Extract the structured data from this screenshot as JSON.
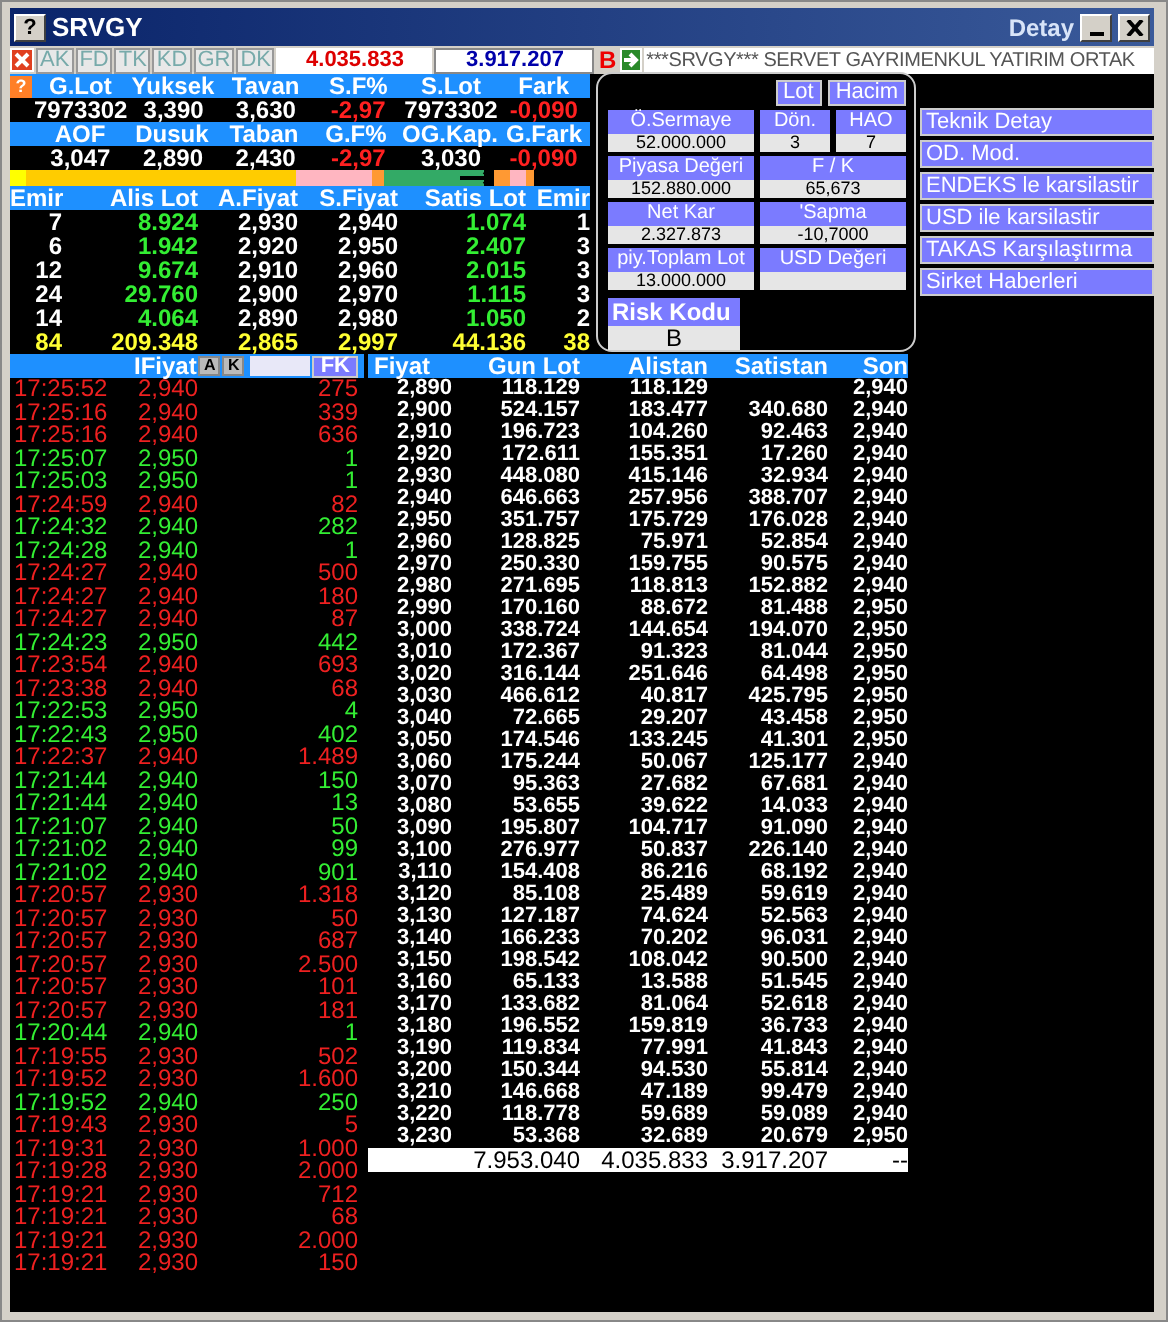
{
  "window": {
    "help": "?",
    "title": "SRVGY",
    "ghost_title": "Detay"
  },
  "toolbar": {
    "tabs": [
      {
        "label": "AK",
        "disabled": true
      },
      {
        "label": "FD",
        "disabled": true
      },
      {
        "label": "TK",
        "disabled": true
      },
      {
        "label": "KD",
        "disabled": true
      },
      {
        "label": "GR",
        "disabled": true
      },
      {
        "label": "DK",
        "disabled": true
      }
    ],
    "buy_total": "4.035.833",
    "sell_total": "3.917.207",
    "risk_letter": "B",
    "ticker": "***SRVGY*** SERVET GAYRIMENKUL YATIRIM ORTAK"
  },
  "stats": {
    "help": "?",
    "rows": [
      {
        "labels": [
          "G.Lot",
          "Yuksek",
          "Tavan",
          "S.F%",
          "S.Lot",
          "Fark"
        ],
        "values": [
          {
            "text": "7973302",
            "negative": false
          },
          {
            "text": "3,390",
            "negative": false
          },
          {
            "text": "3,630",
            "negative": false
          },
          {
            "text": "-2,97",
            "negative": true
          },
          {
            "text": "7973302",
            "negative": false
          },
          {
            "text": "-0,090",
            "negative": true
          }
        ]
      },
      {
        "labels": [
          "AOF",
          "Dusuk",
          "Taban",
          "G.F%",
          "OG.Kap.",
          "G.Fark"
        ],
        "values": [
          {
            "text": "3,047",
            "negative": false
          },
          {
            "text": "2,890",
            "negative": false
          },
          {
            "text": "2,430",
            "negative": false
          },
          {
            "text": "-2,97",
            "negative": true
          },
          {
            "text": "3,030",
            "negative": false
          },
          {
            "text": "-0,090",
            "negative": true
          }
        ]
      }
    ]
  },
  "orderbook": {
    "columns": [
      "Emir",
      "Alis Lot",
      "A.Fiyat",
      "S.Fiyat",
      "Satis Lot",
      "Emir"
    ],
    "rows": [
      [
        "7",
        "8.924",
        "2,930",
        "2,940",
        "1.074",
        "1"
      ],
      [
        "6",
        "1.942",
        "2,920",
        "2,950",
        "2.407",
        "3"
      ],
      [
        "12",
        "9.674",
        "2,910",
        "2,960",
        "2.015",
        "3"
      ],
      [
        "24",
        "29.760",
        "2,900",
        "2,970",
        "1.115",
        "3"
      ],
      [
        "14",
        "4.064",
        "2,890",
        "2,980",
        "1.050",
        "2"
      ]
    ],
    "total": [
      "84",
      "209.348",
      "2,865",
      "2,997",
      "44.136",
      "38"
    ]
  },
  "info_panel": {
    "toggles": [
      "Lot",
      "Hacim"
    ],
    "fields": [
      {
        "label": "Ö.Sermaye",
        "value": "52.000.000"
      },
      {
        "label": "Dön.",
        "value": "3"
      },
      {
        "label": "HAO",
        "value": "7"
      },
      {
        "label": "Piyasa Değeri",
        "value": "152.880.000"
      },
      {
        "label": "F / K",
        "value": "65,673"
      },
      {
        "label": "Net Kar",
        "value": "2.327.873"
      },
      {
        "label": "'Sapma",
        "value": "-10,7000"
      },
      {
        "label": "piy.Toplam Lot",
        "value": "13.000.000"
      },
      {
        "label": "USD Değeri"
      }
    ],
    "risk_label": "Risk Kodu",
    "risk_value": "B"
  },
  "links": [
    "Teknik Detay",
    "OD. Mod.",
    "ENDEKS le karsilastir",
    "USD ile karsilastir",
    "TAKAS Karşılaştırma",
    "Sirket Haberleri"
  ],
  "trades": {
    "header": "IFiyat",
    "buttons": [
      "A",
      "K"
    ],
    "filter_button": "FK",
    "rows": [
      {
        "time": "17:25:52",
        "price": "2,940",
        "lot": "275",
        "kind": "sell"
      },
      {
        "time": "17:25:16",
        "price": "2,940",
        "lot": "339",
        "kind": "sell"
      },
      {
        "time": "17:25:16",
        "price": "2,940",
        "lot": "636",
        "kind": "sell"
      },
      {
        "time": "17:25:07",
        "price": "2,950",
        "lot": "1",
        "kind": "buy"
      },
      {
        "time": "17:25:03",
        "price": "2,950",
        "lot": "1",
        "kind": "buy"
      },
      {
        "time": "17:24:59",
        "price": "2,940",
        "lot": "82",
        "kind": "sell"
      },
      {
        "time": "17:24:32",
        "price": "2,940",
        "lot": "282",
        "kind": "buy"
      },
      {
        "time": "17:24:28",
        "price": "2,940",
        "lot": "1",
        "kind": "buy"
      },
      {
        "time": "17:24:27",
        "price": "2,940",
        "lot": "500",
        "kind": "sell"
      },
      {
        "time": "17:24:27",
        "price": "2,940",
        "lot": "180",
        "kind": "sell"
      },
      {
        "time": "17:24:27",
        "price": "2,940",
        "lot": "87",
        "kind": "sell"
      },
      {
        "time": "17:24:23",
        "price": "2,950",
        "lot": "442",
        "kind": "buy"
      },
      {
        "time": "17:23:54",
        "price": "2,940",
        "lot": "693",
        "kind": "sell"
      },
      {
        "time": "17:23:38",
        "price": "2,940",
        "lot": "68",
        "kind": "sell"
      },
      {
        "time": "17:22:53",
        "price": "2,950",
        "lot": "4",
        "kind": "buy"
      },
      {
        "time": "17:22:43",
        "price": "2,950",
        "lot": "402",
        "kind": "buy"
      },
      {
        "time": "17:22:37",
        "price": "2,940",
        "lot": "1.489",
        "kind": "sell"
      },
      {
        "time": "17:21:44",
        "price": "2,940",
        "lot": "150",
        "kind": "buy"
      },
      {
        "time": "17:21:44",
        "price": "2,940",
        "lot": "13",
        "kind": "buy"
      },
      {
        "time": "17:21:07",
        "price": "2,940",
        "lot": "50",
        "kind": "buy"
      },
      {
        "time": "17:21:02",
        "price": "2,940",
        "lot": "99",
        "kind": "buy"
      },
      {
        "time": "17:21:02",
        "price": "2,940",
        "lot": "901",
        "kind": "buy"
      },
      {
        "time": "17:20:57",
        "price": "2,930",
        "lot": "1.318",
        "kind": "sell"
      },
      {
        "time": "17:20:57",
        "price": "2,930",
        "lot": "50",
        "kind": "sell"
      },
      {
        "time": "17:20:57",
        "price": "2,930",
        "lot": "687",
        "kind": "sell"
      },
      {
        "time": "17:20:57",
        "price": "2,930",
        "lot": "2.500",
        "kind": "sell"
      },
      {
        "time": "17:20:57",
        "price": "2,930",
        "lot": "101",
        "kind": "sell"
      },
      {
        "time": "17:20:57",
        "price": "2,930",
        "lot": "181",
        "kind": "sell"
      },
      {
        "time": "17:20:44",
        "price": "2,940",
        "lot": "1",
        "kind": "buy"
      },
      {
        "time": "17:19:55",
        "price": "2,930",
        "lot": "502",
        "kind": "sell"
      },
      {
        "time": "17:19:52",
        "price": "2,930",
        "lot": "1.600",
        "kind": "sell"
      },
      {
        "time": "17:19:52",
        "price": "2,940",
        "lot": "250",
        "kind": "buy"
      },
      {
        "time": "17:19:43",
        "price": "2,930",
        "lot": "5",
        "kind": "sell"
      },
      {
        "time": "17:19:31",
        "price": "2,930",
        "lot": "1.000",
        "kind": "sell"
      },
      {
        "time": "17:19:28",
        "price": "2,930",
        "lot": "2.000",
        "kind": "sell"
      },
      {
        "time": "17:19:21",
        "price": "2,930",
        "lot": "712",
        "kind": "sell"
      },
      {
        "time": "17:19:21",
        "price": "2,930",
        "lot": "68",
        "kind": "sell"
      },
      {
        "time": "17:19:21",
        "price": "2,930",
        "lot": "2.000",
        "kind": "sell"
      },
      {
        "time": "17:19:21",
        "price": "2,930",
        "lot": "150",
        "kind": "sell"
      }
    ]
  },
  "depth": {
    "columns": [
      "Fiyat",
      "Gun Lot",
      "Alistan",
      "Satistan",
      "Son"
    ],
    "rows": [
      [
        "2,890",
        "118.129",
        "118.129",
        null,
        "2,940"
      ],
      [
        "2,900",
        "524.157",
        "183.477",
        "340.680",
        "2,940"
      ],
      [
        "2,910",
        "196.723",
        "104.260",
        "92.463",
        "2,940"
      ],
      [
        "2,920",
        "172.611",
        "155.351",
        "17.260",
        "2,940"
      ],
      [
        "2,930",
        "448.080",
        "415.146",
        "32.934",
        "2,940"
      ],
      [
        "2,940",
        "646.663",
        "257.956",
        "388.707",
        "2,940"
      ],
      [
        "2,950",
        "351.757",
        "175.729",
        "176.028",
        "2,940"
      ],
      [
        "2,960",
        "128.825",
        "75.971",
        "52.854",
        "2,940"
      ],
      [
        "2,970",
        "250.330",
        "159.755",
        "90.575",
        "2,940"
      ],
      [
        "2,980",
        "271.695",
        "118.813",
        "152.882",
        "2,940"
      ],
      [
        "2,990",
        "170.160",
        "88.672",
        "81.488",
        "2,950"
      ],
      [
        "3,000",
        "338.724",
        "144.654",
        "194.070",
        "2,950"
      ],
      [
        "3,010",
        "172.367",
        "91.323",
        "81.044",
        "2,950"
      ],
      [
        "3,020",
        "316.144",
        "251.646",
        "64.498",
        "2,950"
      ],
      [
        "3,030",
        "466.612",
        "40.817",
        "425.795",
        "2,950"
      ],
      [
        "3,040",
        "72.665",
        "29.207",
        "43.458",
        "2,950"
      ],
      [
        "3,050",
        "174.546",
        "133.245",
        "41.301",
        "2,950"
      ],
      [
        "3,060",
        "175.244",
        "50.067",
        "125.177",
        "2,940"
      ],
      [
        "3,070",
        "95.363",
        "27.682",
        "67.681",
        "2,940"
      ],
      [
        "3,080",
        "53.655",
        "39.622",
        "14.033",
        "2,940"
      ],
      [
        "3,090",
        "195.807",
        "104.717",
        "91.090",
        "2,940"
      ],
      [
        "3,100",
        "276.977",
        "50.837",
        "226.140",
        "2,940"
      ],
      [
        "3,110",
        "154.408",
        "86.216",
        "68.192",
        "2,940"
      ],
      [
        "3,120",
        "85.108",
        "25.489",
        "59.619",
        "2,940"
      ],
      [
        "3,130",
        "127.187",
        "74.624",
        "52.563",
        "2,940"
      ],
      [
        "3,140",
        "166.233",
        "70.202",
        "96.031",
        "2,940"
      ],
      [
        "3,150",
        "198.542",
        "108.042",
        "90.500",
        "2,940"
      ],
      [
        "3,160",
        "65.133",
        "13.588",
        "51.545",
        "2,940"
      ],
      [
        "3,170",
        "133.682",
        "81.064",
        "52.618",
        "2,940"
      ],
      [
        "3,180",
        "196.552",
        "159.819",
        "36.733",
        "2,940"
      ],
      [
        "3,190",
        "119.834",
        "77.991",
        "41.843",
        "2,940"
      ],
      [
        "3,200",
        "150.344",
        "94.530",
        "55.814",
        "2,940"
      ],
      [
        "3,210",
        "146.668",
        "47.189",
        "99.479",
        "2,940"
      ],
      [
        "3,220",
        "118.778",
        "59.689",
        "59.089",
        "2,940"
      ],
      [
        "3,230",
        "53.368",
        "32.689",
        "20.679",
        "2,950"
      ]
    ],
    "total": [
      "7.953.040",
      "4.035.833",
      "3.917.207",
      "--"
    ]
  }
}
